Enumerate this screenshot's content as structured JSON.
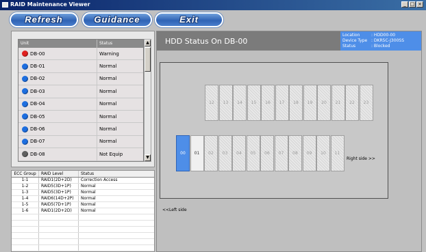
{
  "window": {
    "title": "RAID Maintenance Viewer"
  },
  "toolbar": {
    "refresh": "Refresh",
    "guidance": "Guidance",
    "exit": "Exit"
  },
  "units": {
    "header": {
      "unit": "Unit",
      "status": "Status"
    },
    "rows": [
      {
        "name": "DB-00",
        "status": "Warning",
        "color": "#e02020"
      },
      {
        "name": "DB-01",
        "status": "Normal",
        "color": "#1e6fe0"
      },
      {
        "name": "DB-02",
        "status": "Normal",
        "color": "#1e6fe0"
      },
      {
        "name": "DB-03",
        "status": "Normal",
        "color": "#1e6fe0"
      },
      {
        "name": "DB-04",
        "status": "Normal",
        "color": "#1e6fe0"
      },
      {
        "name": "DB-05",
        "status": "Normal",
        "color": "#1e6fe0"
      },
      {
        "name": "DB-06",
        "status": "Normal",
        "color": "#1e6fe0"
      },
      {
        "name": "DB-07",
        "status": "Normal",
        "color": "#1e6fe0"
      },
      {
        "name": "DB-08",
        "status": "Not Equip",
        "color": "#606060"
      }
    ]
  },
  "ecc": {
    "header": {
      "group": "ECC Group",
      "level": "RAID Level",
      "status": "Status"
    },
    "rows": [
      {
        "group": "1-1",
        "level": "RAID1(2D+2D)",
        "status": "Correction Access"
      },
      {
        "group": "1-2",
        "level": "RAID5(3D+1P)",
        "status": "Normal"
      },
      {
        "group": "1-3",
        "level": "RAID5(3D+1P)",
        "status": "Normal"
      },
      {
        "group": "1-4",
        "level": "RAID6(14D+2P)",
        "status": "Normal"
      },
      {
        "group": "1-5",
        "level": "RAID5(7D+1P)",
        "status": "Normal"
      },
      {
        "group": "1-6",
        "level": "RAID1(2D+2D)",
        "status": "Normal"
      }
    ]
  },
  "hdd": {
    "title": "HDD Status On DB-00",
    "info": [
      {
        "key": "Location",
        "value": ": HDD00-00"
      },
      {
        "key": "Device Type",
        "value": ": DKR5C-J300SS"
      },
      {
        "key": "Status",
        "value": ": Blocked"
      }
    ],
    "top_slots": [
      "12",
      "13",
      "14",
      "15",
      "16",
      "17",
      "18",
      "19",
      "20",
      "21",
      "22",
      "23"
    ],
    "bottom_slots": [
      "00",
      "01",
      "02",
      "03",
      "04",
      "05",
      "06",
      "07",
      "08",
      "09",
      "10",
      "11"
    ],
    "right_label": "Right side >>",
    "left_label": "<<Left side"
  },
  "colors": {
    "selected": "#4e8ee8",
    "warning": "#e02020",
    "normal": "#1e6fe0",
    "not_equip": "#606060"
  }
}
